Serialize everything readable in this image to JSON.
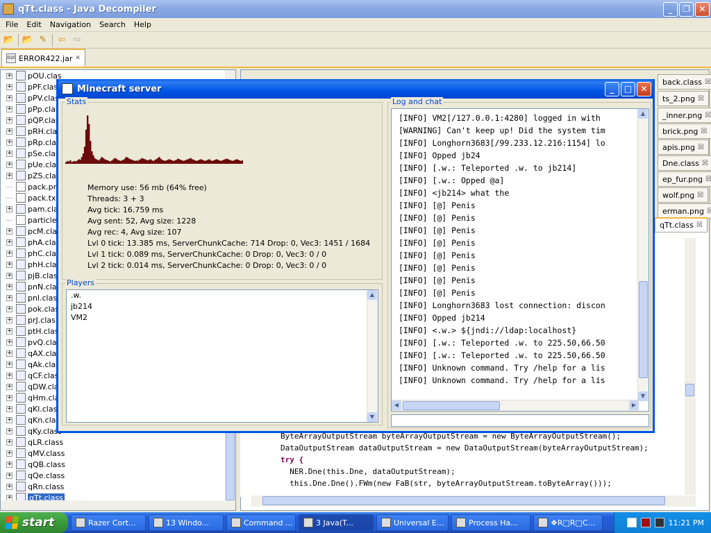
{
  "jd": {
    "title": "qTt.class - Java Decompiler",
    "menu": [
      "File",
      "Edit",
      "Navigation",
      "Search",
      "Help"
    ],
    "jar_tab": "ERROR422.jar",
    "jar_icon": "010"
  },
  "tree": {
    "items": [
      {
        "label": "pOU.clas",
        "type": "class"
      },
      {
        "label": "pPF.clas",
        "type": "class"
      },
      {
        "label": "pPV.clas",
        "type": "class"
      },
      {
        "label": "pPp.clas",
        "type": "class"
      },
      {
        "label": "pQP.clas",
        "type": "class"
      },
      {
        "label": "pRH.clas",
        "type": "class"
      },
      {
        "label": "pRp.clas",
        "type": "class"
      },
      {
        "label": "pSe.clas",
        "type": "class"
      },
      {
        "label": "pUe.clas",
        "type": "class"
      },
      {
        "label": "pZS.clas",
        "type": "class"
      },
      {
        "label": "pack.pn",
        "type": "file"
      },
      {
        "label": "pack.tx",
        "type": "file"
      },
      {
        "label": "pam.clas",
        "type": "class"
      },
      {
        "label": "particles",
        "type": "file"
      },
      {
        "label": "pcM.clas",
        "type": "class"
      },
      {
        "label": "phA.clas",
        "type": "class"
      },
      {
        "label": "phC.clas",
        "type": "class"
      },
      {
        "label": "phH.clas",
        "type": "class"
      },
      {
        "label": "pjB.clas",
        "type": "class"
      },
      {
        "label": "pnN.clas",
        "type": "class"
      },
      {
        "label": "pnl.clas",
        "type": "class"
      },
      {
        "label": "pok.clas",
        "type": "class"
      },
      {
        "label": "prJ.clas",
        "type": "class"
      },
      {
        "label": "ptH.clas",
        "type": "class"
      },
      {
        "label": "pvQ.clas",
        "type": "class"
      },
      {
        "label": "qAX.clas",
        "type": "class"
      },
      {
        "label": "qAk.clas",
        "type": "class"
      },
      {
        "label": "qCF.clas",
        "type": "class"
      },
      {
        "label": "qDW.clas",
        "type": "class"
      },
      {
        "label": "qHm.clas",
        "type": "class"
      },
      {
        "label": "qKl.clas",
        "type": "class"
      },
      {
        "label": "qKn.clas",
        "type": "class"
      },
      {
        "label": "qKy.class",
        "type": "class"
      },
      {
        "label": "qLR.class",
        "type": "class"
      },
      {
        "label": "qMV.class",
        "type": "class"
      },
      {
        "label": "qQB.class",
        "type": "class"
      },
      {
        "label": "qQe.class",
        "type": "class"
      },
      {
        "label": "qRn.class",
        "type": "class"
      },
      {
        "label": "qTt.class",
        "type": "class",
        "selected": true
      }
    ]
  },
  "editor": {
    "tabs": [
      "back.class",
      "ts_2.png",
      "_inner.png",
      "brick.png",
      "apis.png",
      "Dne.class",
      "ep_fur.png",
      "wolf.png",
      "erman.png",
      "qTt.class"
    ],
    "code": [
      "ByteArrayOutputStream byteArrayOutputStream = new ByteArrayOutputStream();",
      "DataOutputStream dataOutputStream = new DataOutputStream(byteArrayOutputStream);",
      "try {",
      "  NER.Dne(this.Dne, dataOutputStream);",
      "  this.Dne.Dne().FWm(new FaB(str, byteArrayOutputStream.toByteArray()));"
    ]
  },
  "mc": {
    "title": "Minecraft server",
    "stats_title": "Stats",
    "stats": [
      "Memory use: 56 mb (64% free)",
      "Threads: 3 + 3",
      "Avg tick: 16.759 ms",
      "Avg sent: 52, Avg size: 1228",
      "Avg rec: 4, Avg size: 107",
      "Lvl 0 tick: 13.385 ms, ServerChunkCache: 714 Drop: 0, Vec3: 1451 / 1684",
      "Lvl 1 tick: 0.089 ms, ServerChunkCache: 0 Drop: 0, Vec3: 0 / 0",
      "Lvl 2 tick: 0.014 ms, ServerChunkCache: 0 Drop: 0, Vec3: 0 / 0"
    ],
    "players_title": "Players",
    "players": [
      ".w.",
      "jb214",
      "VM2"
    ],
    "log_title": "Log and chat",
    "log": [
      "[INFO] VM2[/127.0.0.1:4280] logged in with",
      "[WARNING] Can't keep up! Did the system tim",
      "[INFO] Longhorn3683[/99.233.12.216:1154] lo",
      "[INFO] Opped jb24",
      "[INFO] [.w.: Teleported .w. to jb214]",
      "[INFO] [.w.: Opped @a]",
      "[INFO] <jb214> what the",
      "[INFO] [@] Penis",
      "[INFO] [@] Penis",
      "[INFO] [@] Penis",
      "[INFO] [@] Penis",
      "[INFO] [@] Penis",
      "[INFO] [@] Penis",
      "[INFO] [@] Penis",
      "[INFO] [@] Penis",
      "[INFO] Longhorn3683 lost connection: discon",
      "[INFO] Opped jb214",
      "[INFO] <.w.> ${jndi://ldap:localhost}",
      "[INFO] [.w.: Teleported .w. to 225.50,66.50",
      "[INFO] [.w.: Teleported .w. to 225.50,66.50",
      "[INFO] Unknown command. Try /help for a lis",
      "[INFO] Unknown command. Try /help for a lis"
    ],
    "chat_value": ""
  },
  "chart_data": {
    "type": "area",
    "values": [
      3,
      5,
      4,
      6,
      3,
      4,
      5,
      4,
      6,
      8,
      7,
      12,
      18,
      30,
      60,
      85,
      70,
      40,
      22,
      15,
      10,
      8,
      7,
      6,
      9,
      12,
      10,
      8,
      7,
      6,
      5,
      4,
      6,
      8,
      10,
      9,
      7,
      6,
      5,
      6,
      7,
      9,
      12,
      11,
      9,
      8,
      7,
      6,
      5,
      6,
      5,
      7,
      8,
      10,
      9,
      8,
      7,
      6,
      7,
      8,
      6,
      5,
      7,
      8,
      10,
      12,
      9,
      7,
      6,
      5,
      6,
      7,
      8,
      7,
      6,
      5,
      6,
      7,
      9,
      8,
      7,
      6,
      5,
      6,
      7,
      8,
      9,
      10,
      8,
      7,
      6,
      5,
      6,
      7,
      8,
      7,
      6,
      5,
      6,
      7,
      8,
      6,
      5,
      6,
      7,
      8,
      7,
      6,
      5,
      6,
      7,
      8,
      9,
      8,
      7,
      6,
      5,
      6,
      7,
      8,
      7,
      6,
      5,
      6
    ],
    "ylim": [
      0,
      100
    ],
    "color": "#6b0a0a"
  },
  "taskbar": {
    "start": "start",
    "tasks": [
      "Razer Cort...",
      "13 Windo...",
      "Command ...",
      "3 Java(T...",
      "Universal E...",
      "Process Ha...",
      "❖R□R□C..."
    ],
    "active_index": 3,
    "clock": "11:21 PM"
  }
}
